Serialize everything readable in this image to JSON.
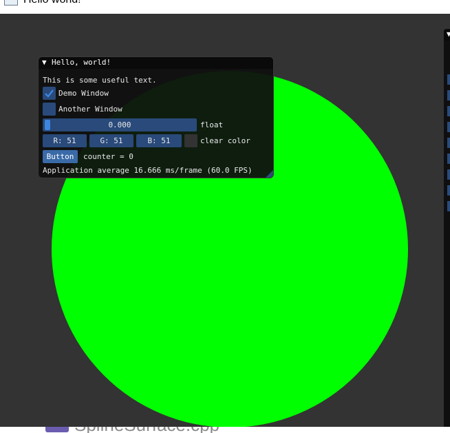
{
  "os_window": {
    "title": "Hello world!"
  },
  "background_app": {
    "text": "SplineSurface.cpp"
  },
  "imgui_window": {
    "title": "Hello, world!",
    "text": "This is some useful text.",
    "checkboxes": [
      {
        "label": "Demo Window",
        "checked": true
      },
      {
        "label": "Another Window",
        "checked": false
      }
    ],
    "slider": {
      "value": "0.000",
      "label": "float",
      "fraction": 0.0
    },
    "clear_color": {
      "r": "R: 51",
      "g": "G: 51",
      "b": "B: 51",
      "label": "clear color",
      "swatch_color": "#333333"
    },
    "button": {
      "label": "Button"
    },
    "counter": "counter = 0",
    "fps": "Application average 16.666 ms/frame (60.0 FPS)"
  },
  "colors": {
    "viewport_bg": "#333333",
    "circle": "#00ff00",
    "frame_bg": "#294a7a",
    "button": "#3a6aa8",
    "accent": "#3d85e0"
  },
  "icons": {
    "collapse": "collapse-arrow-icon",
    "check": "checkmark-icon",
    "app": "app-icon"
  }
}
